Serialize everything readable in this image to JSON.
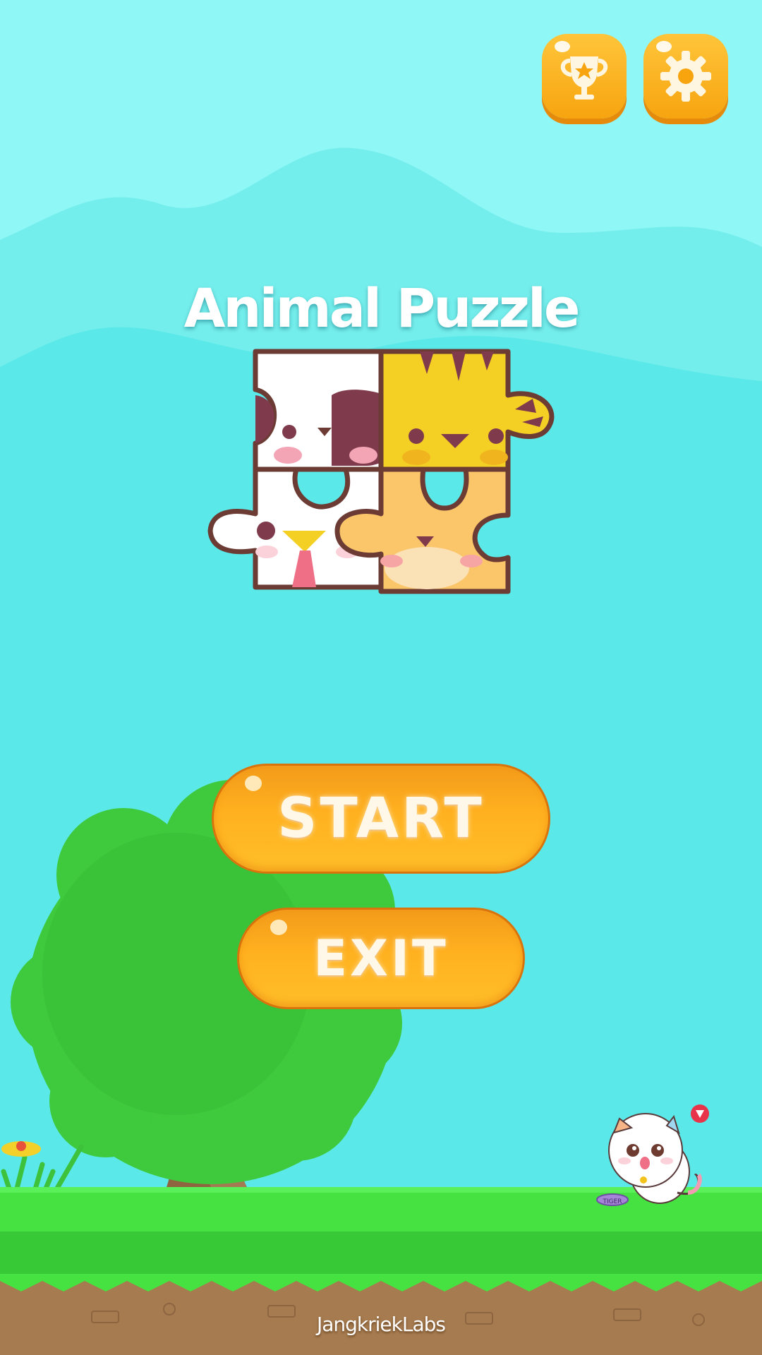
{
  "game": {
    "title": "Animal Puzzle",
    "start_label": "START",
    "exit_label": "EXIT",
    "brand": "JangkriekLabs",
    "bowl_label": "TIGER"
  },
  "top_buttons": {
    "trophy_icon": "trophy-icon",
    "settings_icon": "gear-icon"
  },
  "colors": {
    "sky": "#8ff7f6",
    "button_orange": "#f7a40f",
    "grass": "#46e241",
    "soil": "#a67b4f"
  }
}
